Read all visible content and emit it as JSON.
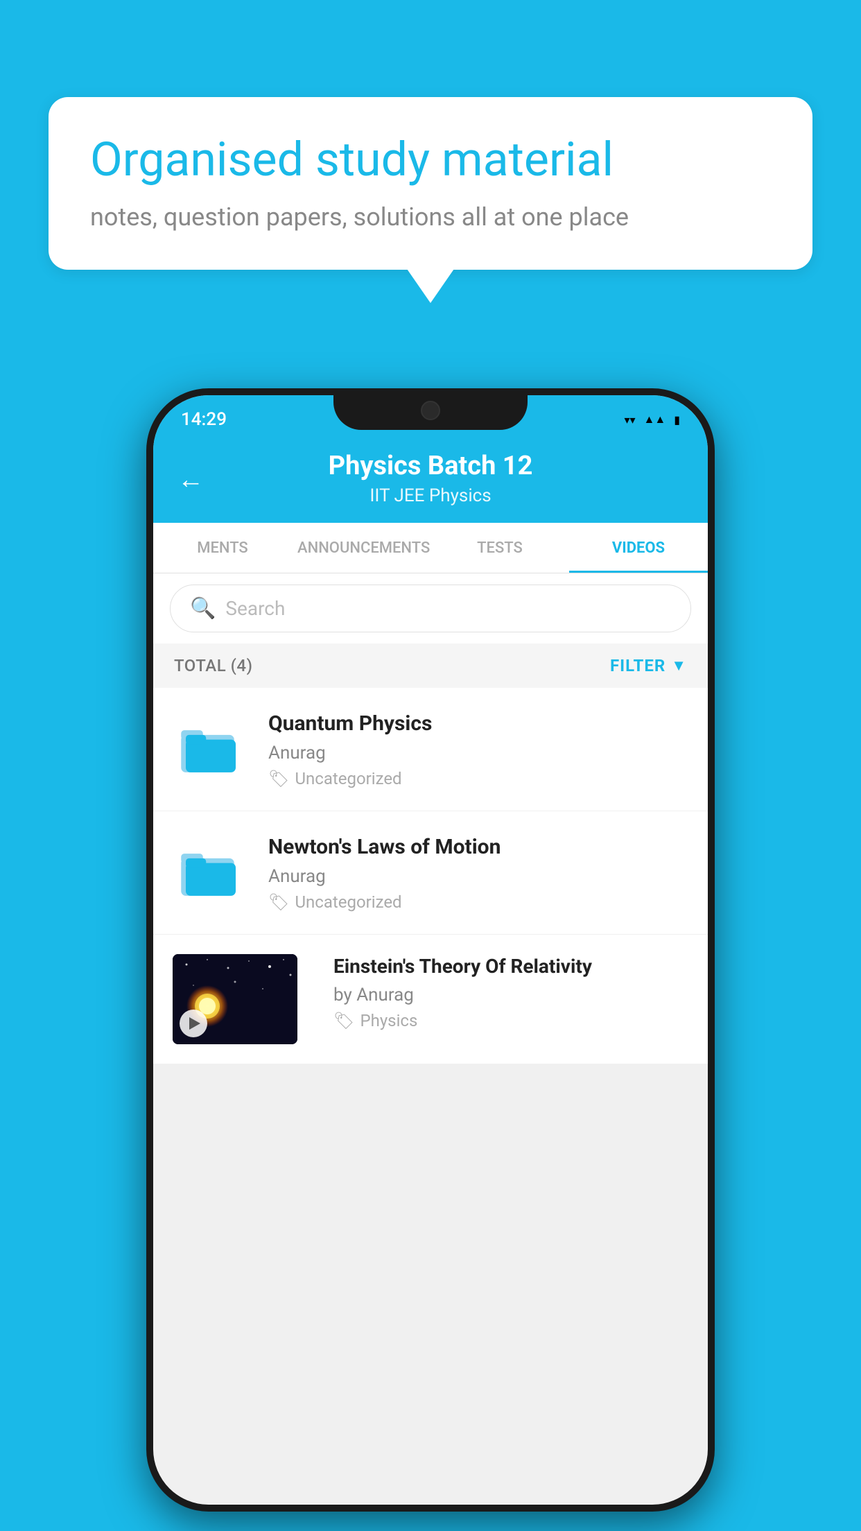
{
  "background_color": "#1ab9e8",
  "bubble": {
    "title": "Organised study material",
    "subtitle": "notes, question papers, solutions all at one place"
  },
  "phone": {
    "status_bar": {
      "time": "14:29",
      "icons": [
        "wifi",
        "signal",
        "battery"
      ]
    },
    "header": {
      "back_label": "←",
      "title": "Physics Batch 12",
      "subtitle": "IIT JEE   Physics"
    },
    "tabs": [
      {
        "label": "MENTS",
        "active": false
      },
      {
        "label": "ANNOUNCEMENTS",
        "active": false
      },
      {
        "label": "TESTS",
        "active": false
      },
      {
        "label": "VIDEOS",
        "active": true
      }
    ],
    "search": {
      "placeholder": "Search"
    },
    "filter_bar": {
      "total_label": "TOTAL (4)",
      "filter_label": "FILTER"
    },
    "videos": [
      {
        "id": 1,
        "title": "Quantum Physics",
        "author": "Anurag",
        "tag": "Uncategorized",
        "thumb_type": "folder"
      },
      {
        "id": 2,
        "title": "Newton's Laws of Motion",
        "author": "Anurag",
        "tag": "Uncategorized",
        "thumb_type": "folder"
      },
      {
        "id": 3,
        "title": "Einstein's Theory Of Relativity",
        "author": "by Anurag",
        "tag": "Physics",
        "thumb_type": "image"
      }
    ]
  }
}
